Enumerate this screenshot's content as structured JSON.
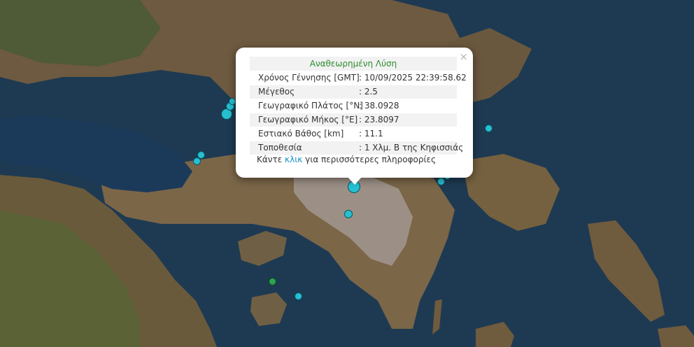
{
  "popup": {
    "title": "Αναθεωρημένη Λύση",
    "close_icon": "×",
    "rows": [
      {
        "label": "Χρόνος Γέννησης [GMT]",
        "value": ": 10/09/2025 22:39:58.62"
      },
      {
        "label": "Μέγεθος",
        "value": ": 2.5"
      },
      {
        "label": "Γεωγραφικό Πλάτος [°N]",
        "value": ": 38.0928"
      },
      {
        "label": "Γεωγραφικό Μήκος [°E]",
        "value": ": 23.8097"
      },
      {
        "label": "Εστιακό Βάθος [km]",
        "value": ": 11.1"
      },
      {
        "label": "Τοποθεσία",
        "value": ": 1 Χλμ. Β της Κηφισσιάς"
      }
    ],
    "more_prefix": "Κάντε",
    "more_link": "κλικ",
    "more_suffix": "για περισσότερες πληροφορίες"
  },
  "colors": {
    "marker": "#26c0d3",
    "marker_green": "#2ea44f",
    "title_green": "#2e8b2e",
    "link_blue": "#1a8fc9",
    "sea": "#1e3a52",
    "land": "#7a6548"
  },
  "markers": [
    {
      "name": "earthquake-marker-selected",
      "color": "cyan"
    },
    {
      "name": "earthquake-marker",
      "color": "cyan"
    },
    {
      "name": "earthquake-marker",
      "color": "cyan"
    },
    {
      "name": "earthquake-marker",
      "color": "cyan"
    },
    {
      "name": "earthquake-marker",
      "color": "cyan"
    },
    {
      "name": "earthquake-marker",
      "color": "cyan"
    },
    {
      "name": "earthquake-marker",
      "color": "cyan"
    },
    {
      "name": "earthquake-marker",
      "color": "cyan"
    },
    {
      "name": "earthquake-marker",
      "color": "cyan"
    },
    {
      "name": "earthquake-marker",
      "color": "cyan"
    },
    {
      "name": "earthquake-marker",
      "color": "green"
    },
    {
      "name": "earthquake-marker",
      "color": "cyan"
    }
  ]
}
